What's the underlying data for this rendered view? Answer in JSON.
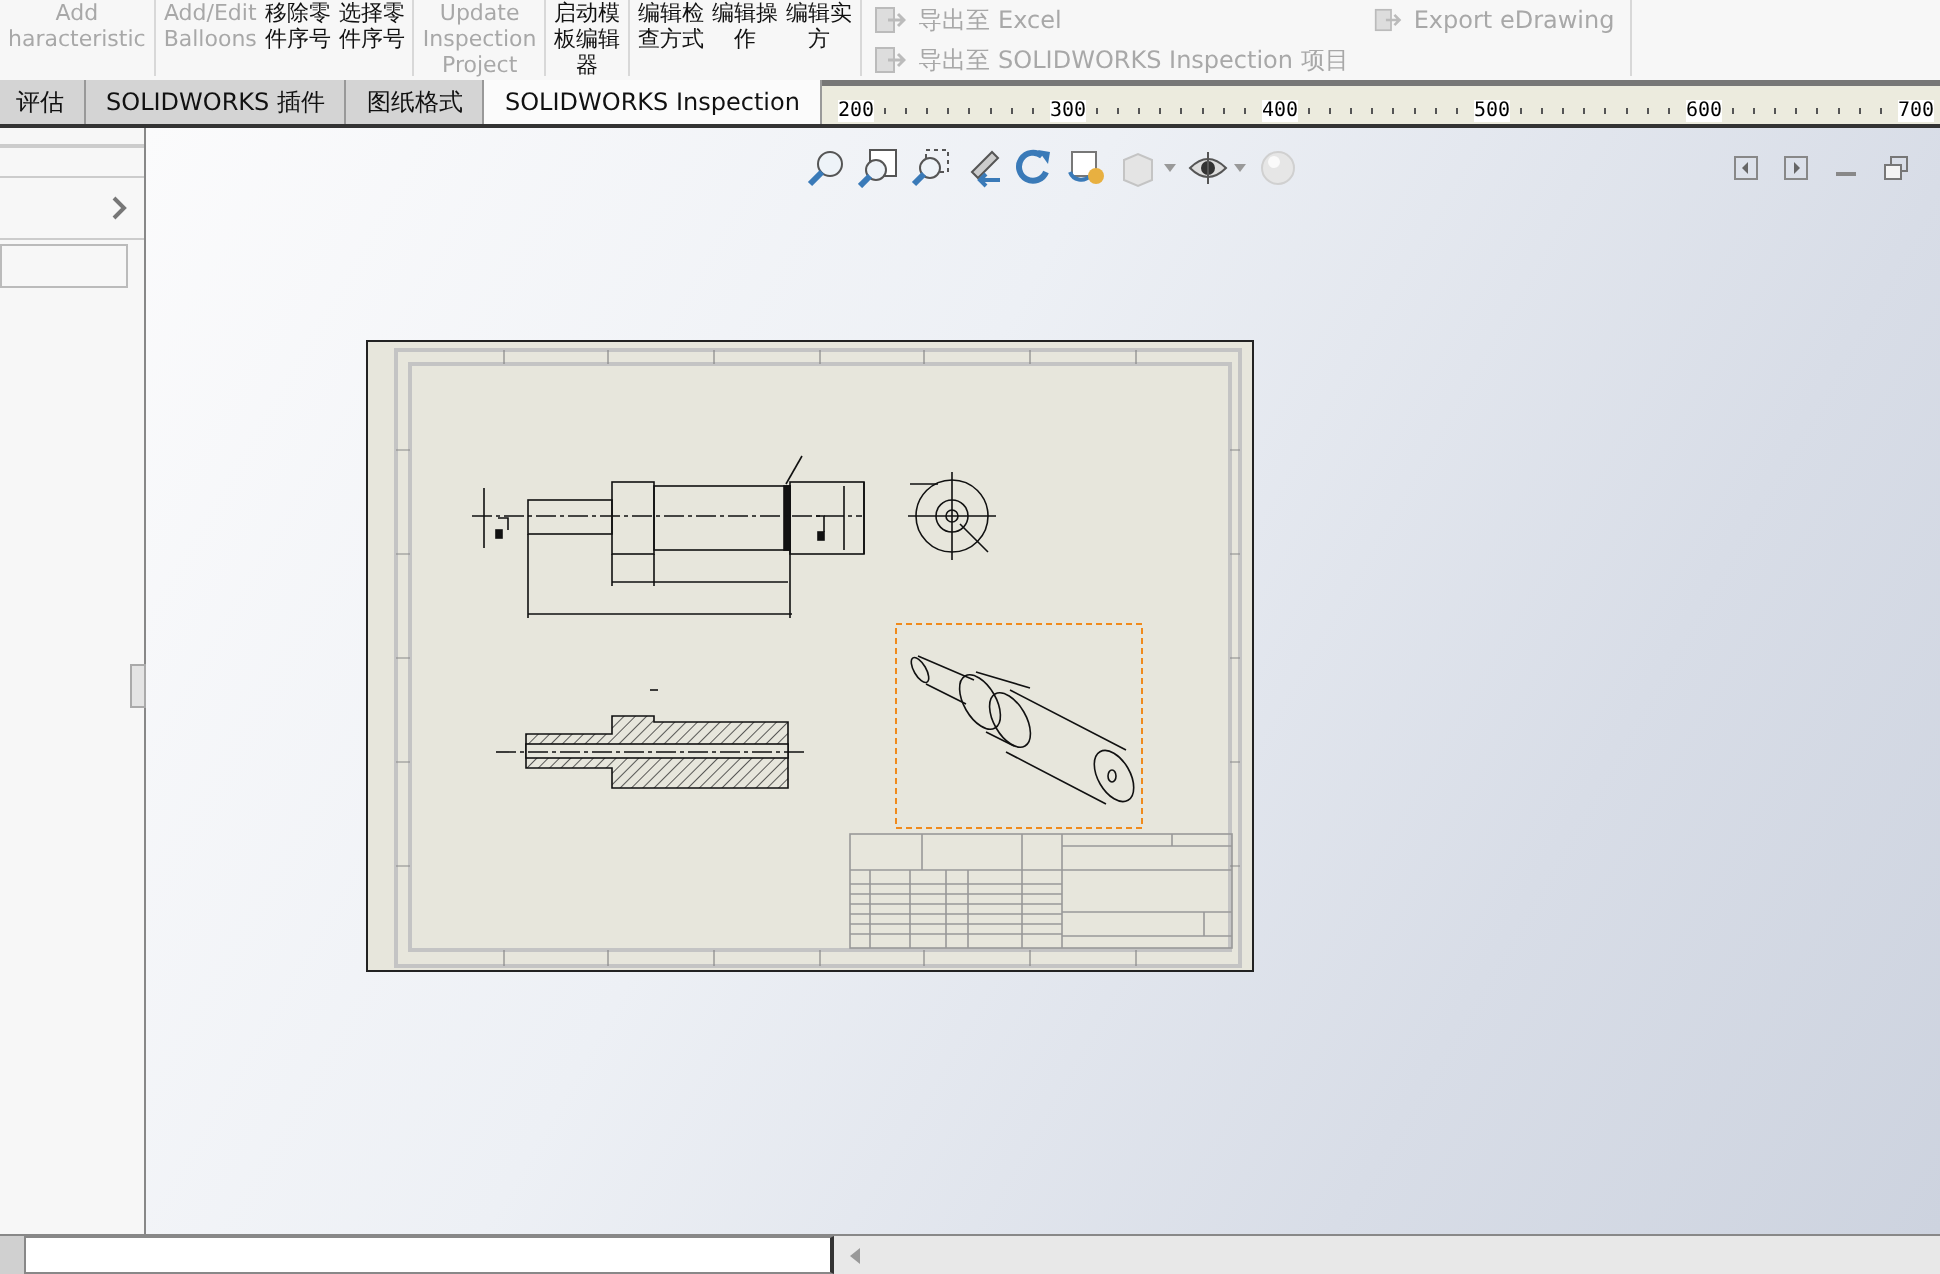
{
  "toolbar": {
    "groups": [
      [
        {
          "lines": [
            "Add",
            "haracteristic"
          ],
          "disabled": true
        }
      ],
      [
        {
          "lines": [
            "Add/Edit",
            "Balloons"
          ],
          "disabled": true
        },
        {
          "lines": [
            "移除零",
            "件序号"
          ],
          "disabled": false
        },
        {
          "lines": [
            "选择零",
            "件序号"
          ],
          "disabled": false
        }
      ],
      [
        {
          "lines": [
            "Update",
            "Inspection",
            "Project"
          ],
          "disabled": true
        }
      ],
      [
        {
          "lines": [
            "启动模",
            "板编辑",
            "器"
          ],
          "disabled": false
        }
      ],
      [
        {
          "lines": [
            "编辑检",
            "查方式"
          ],
          "disabled": false
        },
        {
          "lines": [
            "编辑操",
            "作"
          ],
          "disabled": false
        },
        {
          "lines": [
            "编辑实",
            "方"
          ],
          "disabled": false
        }
      ]
    ],
    "export_items": [
      {
        "label": "导出至 Excel",
        "disabled": true
      },
      {
        "label": "Export eDrawing",
        "disabled": true
      },
      {
        "label": "导出至 SOLIDWORKS Inspection 项目",
        "disabled": true
      }
    ]
  },
  "tabs": [
    {
      "label": "评估",
      "selected": false
    },
    {
      "label": "SOLIDWORKS 插件",
      "selected": false
    },
    {
      "label": "图纸格式",
      "selected": false
    },
    {
      "label": "SOLIDWORKS Inspection",
      "selected": true
    }
  ],
  "ruler": {
    "labels": [
      "200",
      "300",
      "400",
      "500",
      "600",
      "700"
    ]
  }
}
